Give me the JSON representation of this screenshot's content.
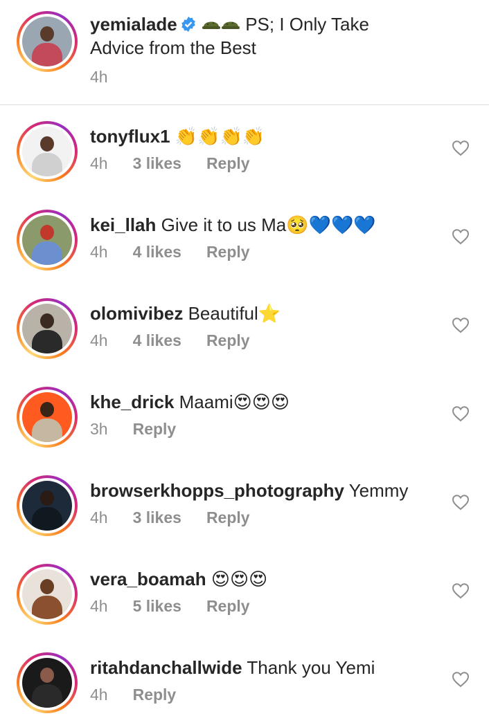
{
  "caption": {
    "username": "yemialade",
    "text_line1": " PS; I  Only Take",
    "text_line2": "Advice from the Best",
    "time": "4h"
  },
  "comments": [
    {
      "username": "tonyflux1",
      "text": "",
      "emoji": "👏👏👏👏",
      "time": "4h",
      "likes": "3 likes",
      "reply": "Reply",
      "avatar_bg": "#f2f2f2",
      "avatar_head": "#5a3a2a",
      "avatar_body": "#d0d0d0"
    },
    {
      "username": "kei_llah",
      "text": "Give it to us Ma",
      "emoji": "🥺💙💙💙",
      "time": "4h",
      "likes": "4 likes",
      "reply": "Reply",
      "avatar_bg": "#8b9a6a",
      "avatar_head": "#c0392b",
      "avatar_body": "#6b8fcf"
    },
    {
      "username": "olomivibez",
      "text": "Beautiful",
      "emoji": "⭐",
      "time": "4h",
      "likes": "4 likes",
      "reply": "Reply",
      "avatar_bg": "#b8b2a8",
      "avatar_head": "#3b2a22",
      "avatar_body": "#2a2a2a"
    },
    {
      "username": "khe_drick",
      "text": "Maami",
      "emoji": "😍😍😍",
      "time": "3h",
      "likes": "",
      "reply": "Reply",
      "avatar_bg": "#ff5a1f",
      "avatar_head": "#3a2418",
      "avatar_body": "#c6b8a0"
    },
    {
      "username": "browserkhopps_photography",
      "text": "Yemmy",
      "emoji": "",
      "time": "4h",
      "likes": "3 likes",
      "reply": "Reply",
      "avatar_bg": "#1d2a3a",
      "avatar_head": "#2a1c14",
      "avatar_body": "#101820"
    },
    {
      "username": "vera_boamah",
      "text": "",
      "emoji": "😍😍😍",
      "time": "4h",
      "likes": "5 likes",
      "reply": "Reply",
      "avatar_bg": "#e9e2da",
      "avatar_head": "#6a3e24",
      "avatar_body": "#8a5030"
    },
    {
      "username": "ritahdanchallwide",
      "text": "Thank you Yemi",
      "emoji": "",
      "time": "4h",
      "likes": "",
      "reply": "Reply",
      "avatar_bg": "#1a1a1a",
      "avatar_head": "#8a5a4a",
      "avatar_body": "#2a2a2a"
    }
  ],
  "colors": {
    "verified": "#3897f0",
    "secondary_text": "#8e8e8e",
    "divider": "#dbdbdb"
  },
  "icons": {
    "caption": [
      "verified-badge-icon",
      "helmet-emoji-icon"
    ],
    "comment": "heart-outline-icon"
  }
}
